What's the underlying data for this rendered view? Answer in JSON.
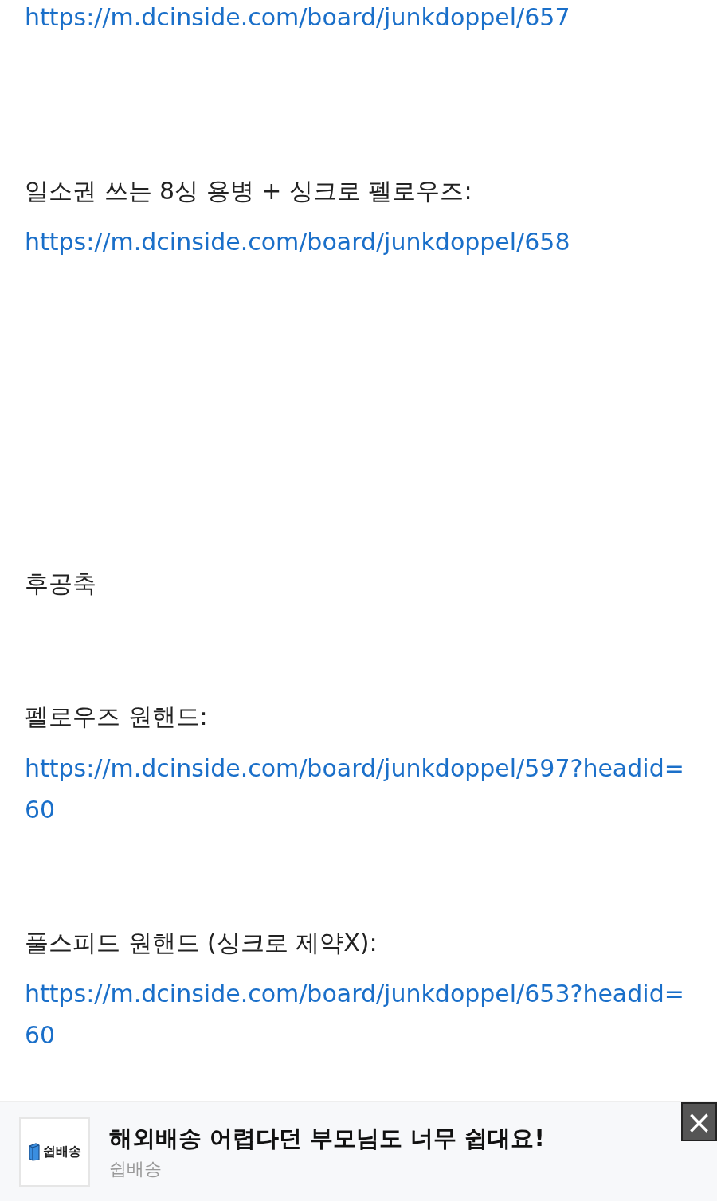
{
  "content": [
    {
      "kind": "link",
      "text": "https://m.dcinside.com/board/junkdoppel/657"
    },
    {
      "kind": "text",
      "text": "일소권 쓰는 8싱 용병 + 싱크로 펠로우즈:"
    },
    {
      "kind": "link",
      "text": "https://m.dcinside.com/board/junkdoppel/658"
    },
    {
      "kind": "text",
      "text": "후공축"
    },
    {
      "kind": "text",
      "text": "펠로우즈 원핸드:"
    },
    {
      "kind": "link",
      "text": "https://m.dcinside.com/board/junkdoppel/597?headid=60"
    },
    {
      "kind": "text",
      "text": "풀스피드 원핸드 (싱크로 제약X):"
    },
    {
      "kind": "link",
      "text": "https://m.dcinside.com/board/junkdoppel/653?headid=60"
    }
  ],
  "ad": {
    "logo_text": "쉽배송",
    "title": "해외배송 어렵다던 부모님도 너무 쉽대요!",
    "advertiser": "쉽배송",
    "close": "×"
  }
}
